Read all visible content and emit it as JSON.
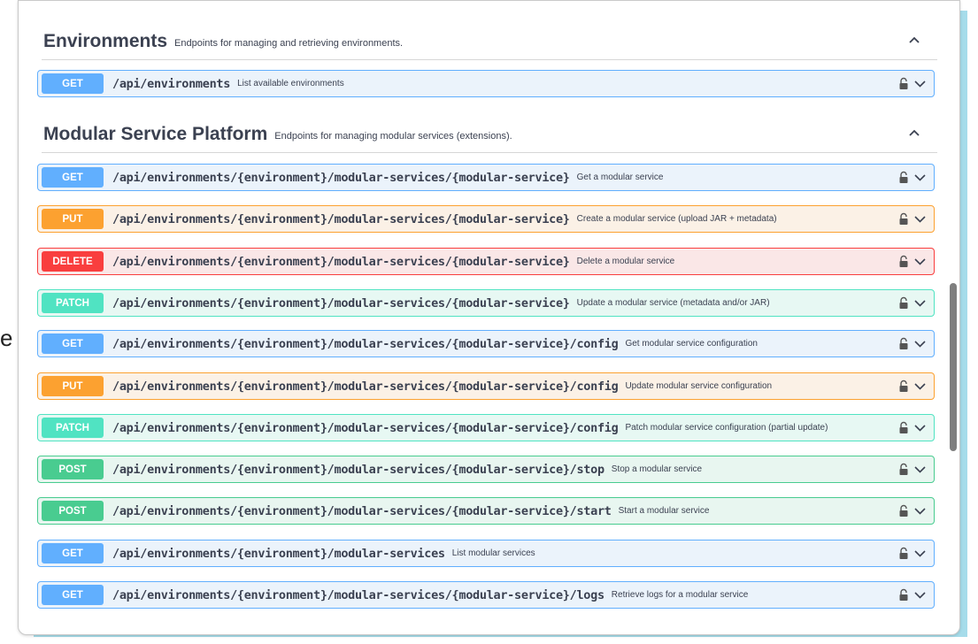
{
  "sections": {
    "environments": {
      "title": "Environments",
      "description": "Endpoints for managing and retrieving environments.",
      "chevron": "chevron-up-icon"
    },
    "modular": {
      "title": "Modular Service Platform",
      "description": "Endpoints for managing modular services (extensions).",
      "chevron": "chevron-up-icon"
    }
  },
  "operations": [
    {
      "method": "GET",
      "path": "/api/environments",
      "summary": "List available environments"
    },
    {
      "method": "GET",
      "path": "/api/environments/{environment}/modular-services/{modular-service}",
      "summary": "Get a modular service"
    },
    {
      "method": "PUT",
      "path": "/api/environments/{environment}/modular-services/{modular-service}",
      "summary": "Create a modular service (upload JAR + metadata)"
    },
    {
      "method": "DELETE",
      "path": "/api/environments/{environment}/modular-services/{modular-service}",
      "summary": "Delete a modular service"
    },
    {
      "method": "PATCH",
      "path": "/api/environments/{environment}/modular-services/{modular-service}",
      "summary": "Update a modular service (metadata and/or JAR)"
    },
    {
      "method": "GET",
      "path": "/api/environments/{environment}/modular-services/{modular-service}/config",
      "summary": "Get modular service configuration"
    },
    {
      "method": "PUT",
      "path": "/api/environments/{environment}/modular-services/{modular-service}/config",
      "summary": "Update modular service configuration"
    },
    {
      "method": "PATCH",
      "path": "/api/environments/{environment}/modular-services/{modular-service}/config",
      "summary": "Patch modular service configuration (partial update)"
    },
    {
      "method": "POST",
      "path": "/api/environments/{environment}/modular-services/{modular-service}/stop",
      "summary": "Stop a modular service"
    },
    {
      "method": "POST",
      "path": "/api/environments/{environment}/modular-services/{modular-service}/start",
      "summary": "Start a modular service"
    },
    {
      "method": "GET",
      "path": "/api/environments/{environment}/modular-services",
      "summary": "List modular services"
    },
    {
      "method": "GET",
      "path": "/api/environments/{environment}/modular-services/{modular-service}/logs",
      "summary": "Retrieve logs for a modular service"
    }
  ],
  "icons": {
    "lock": "lock-icon",
    "expand": "chevron-down-icon"
  },
  "colors": {
    "GET": "#61affe",
    "PUT": "#fca130",
    "DELETE": "#f93e3e",
    "PATCH": "#50e3c2",
    "POST": "#49cc90"
  },
  "left_edge_glyph": "e"
}
